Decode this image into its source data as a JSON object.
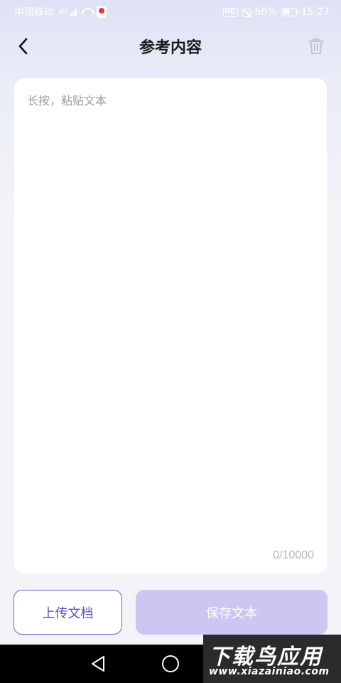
{
  "status_bar": {
    "carrier": "中国移动",
    "network_type": "4G",
    "hd_label": "HD",
    "battery_percent": "50%",
    "time": "15:27"
  },
  "header": {
    "title": "参考内容"
  },
  "editor": {
    "placeholder": "长按，粘贴文本",
    "counter": "0/10000"
  },
  "actions": {
    "upload_label": "上传文档",
    "save_label": "保存文本"
  },
  "watermark": {
    "title": "下载鸟应用",
    "url": "www.xiazainiao.com"
  },
  "colors": {
    "accent": "#6e5fd9",
    "save_disabled": "#ccc6f3"
  }
}
